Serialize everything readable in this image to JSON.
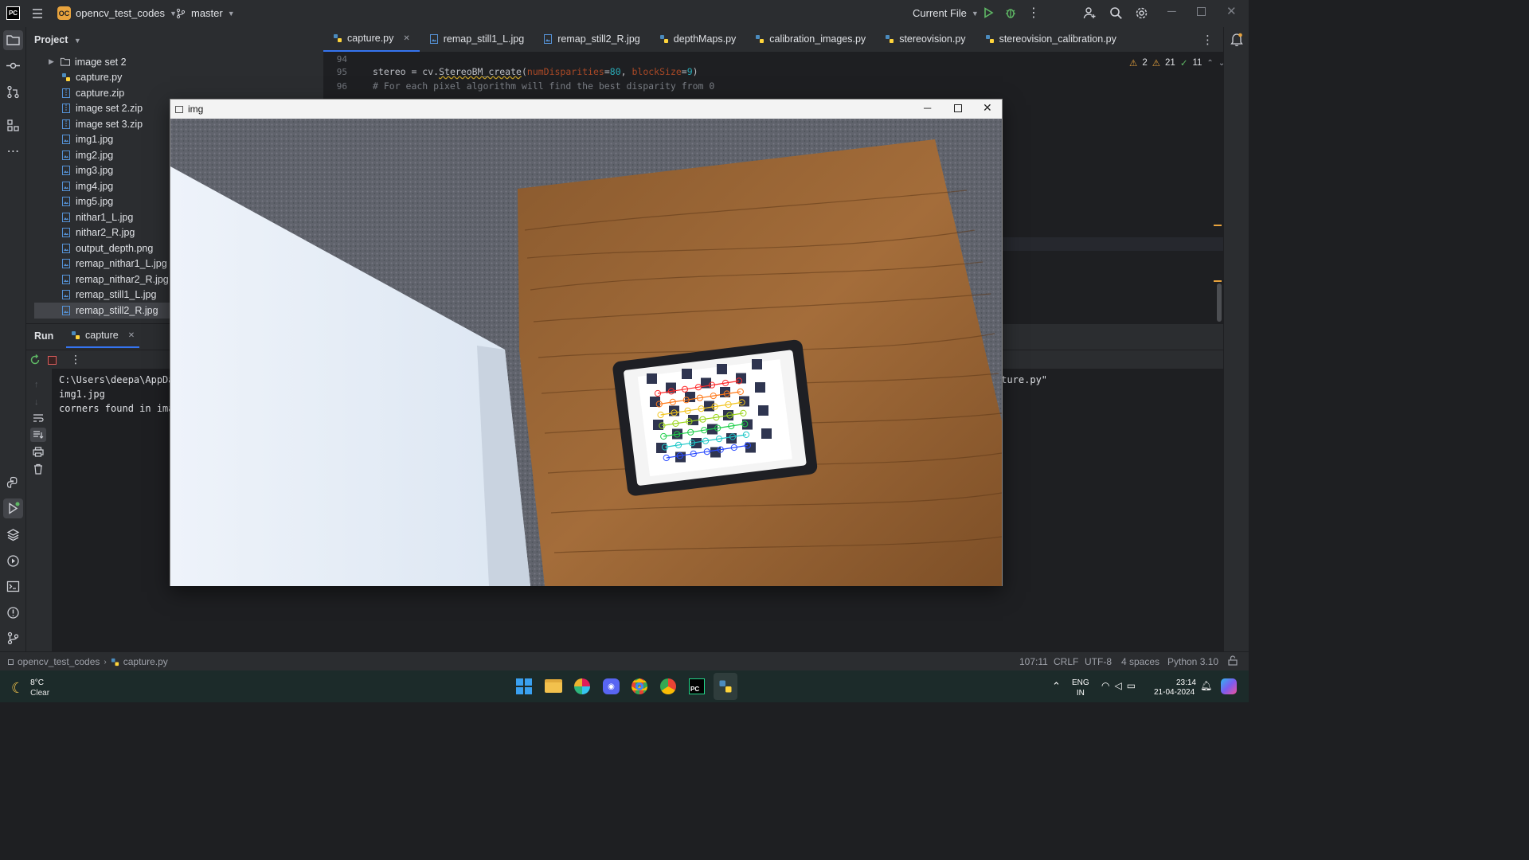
{
  "titlebar": {
    "project_badge": "OC",
    "project_name": "opencv_test_codes",
    "branch": "master",
    "run_config": "Current File"
  },
  "project_panel": {
    "title": "Project",
    "items": [
      {
        "label": "image set 2",
        "type": "folder"
      },
      {
        "label": "capture.py",
        "type": "python"
      },
      {
        "label": "capture.zip",
        "type": "archive"
      },
      {
        "label": "image set 2.zip",
        "type": "archive"
      },
      {
        "label": "image set 3.zip",
        "type": "archive"
      },
      {
        "label": "img1.jpg",
        "type": "image"
      },
      {
        "label": "img2.jpg",
        "type": "image"
      },
      {
        "label": "img3.jpg",
        "type": "image"
      },
      {
        "label": "img4.jpg",
        "type": "image"
      },
      {
        "label": "img5.jpg",
        "type": "image"
      },
      {
        "label": "nithar1_L.jpg",
        "type": "image"
      },
      {
        "label": "nithar2_R.jpg",
        "type": "image"
      },
      {
        "label": "output_depth.png",
        "type": "image"
      },
      {
        "label": "remap_nithar1_L.jpg",
        "type": "image"
      },
      {
        "label": "remap_nithar2_R.jpg",
        "type": "image"
      },
      {
        "label": "remap_still1_L.jpg",
        "type": "image"
      },
      {
        "label": "remap_still2_R.jpg",
        "type": "image"
      }
    ]
  },
  "tabs": [
    {
      "label": "capture.py",
      "type": "python",
      "active": true
    },
    {
      "label": "remap_still1_L.jpg",
      "type": "image"
    },
    {
      "label": "remap_still2_R.jpg",
      "type": "image"
    },
    {
      "label": "depthMaps.py",
      "type": "python"
    },
    {
      "label": "calibration_images.py",
      "type": "python"
    },
    {
      "label": "stereovision.py",
      "type": "python"
    },
    {
      "label": "stereovision_calibration.py",
      "type": "python"
    }
  ],
  "editor": {
    "lines": [
      {
        "num": "94",
        "text": ""
      },
      {
        "num": "95",
        "text": "stereo = cv.StereoBM_create(numDisparities=80, blockSize=9)"
      },
      {
        "num": "96",
        "text": "# For each pixel algorithm will find the best disparity from 0"
      }
    ],
    "inspections": {
      "warnings_a": "2",
      "warnings_b": "21",
      "ok": "11"
    }
  },
  "run_panel": {
    "title": "Run",
    "tab_label": "capture",
    "console": [
      "C:\\Users\\deepa\\AppDat",
      "img1.jpg",
      "corners found in imag"
    ],
    "console_tail": "pture.py\""
  },
  "image_window": {
    "title": "img"
  },
  "statusbar": {
    "breadcrumb_project": "opencv_test_codes",
    "breadcrumb_file": "capture.py",
    "position": "107:11",
    "line_sep": "CRLF",
    "encoding": "UTF-8",
    "indent": "4 spaces",
    "interpreter": "Python 3.10"
  },
  "taskbar": {
    "weather_temp": "8°C",
    "weather_desc": "Clear",
    "lang": "ENG",
    "region": "IN",
    "time": "23:14",
    "date": "21-04-2024"
  },
  "colors": {
    "accent": "#3574f0",
    "python_icon": "#4b8bbe",
    "image_icon": "#5592d6",
    "warning": "#e8a33d",
    "ok": "#5fb865"
  }
}
